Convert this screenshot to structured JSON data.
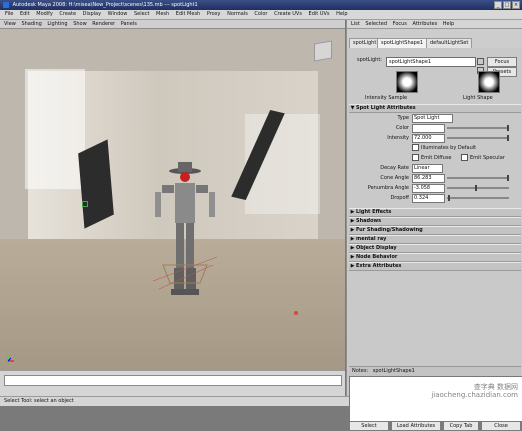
{
  "window": {
    "title": "Autodesk Maya 2008: H:\\misea\\New_Project\\scenes\\135.mb   ---   spotLight1",
    "buttons": [
      "_",
      "□",
      "×"
    ]
  },
  "main_menu": [
    "File",
    "Edit",
    "Modify",
    "Create",
    "Display",
    "Window",
    "Select",
    "Mesh",
    "Edit Mesh",
    "Proxy",
    "Normals",
    "Color",
    "Create UVs",
    "Edit UVs",
    "Help"
  ],
  "viewport_menu": [
    "View",
    "Shading",
    "Lighting",
    "Show",
    "Renderer",
    "Panels"
  ],
  "panel_menu": [
    "List",
    "Selected",
    "Focus",
    "Attributes",
    "Help"
  ],
  "tabs": [
    "spotLight1",
    "spotLightShape1",
    "defaultLightSet"
  ],
  "spotlight": {
    "label": "spotLight:",
    "value": "spotLightShape1",
    "focus": "Focus",
    "presets": "Presets",
    "intensity_sample": "Intensity Sample",
    "light_shape": "Light Shape"
  },
  "spot_light_attributes": {
    "title": "Spot Light Attributes",
    "type_label": "Type",
    "type_value": "Spot Light",
    "color_label": "Color",
    "intensity_label": "Intensity",
    "intensity_value": "72.000",
    "intensity_level": 0.72,
    "illuminates": "Illuminates by Default",
    "emit_diffuse": "Emit Diffuse",
    "emit_specular": "Emit Specular",
    "decay_label": "Decay Rate",
    "decay_value": "Linear",
    "cone_label": "Cone Angle",
    "cone_value": "86.283",
    "penumbra_label": "Penumbra Angle",
    "penumbra_value": "-3.058",
    "dropoff_label": "Dropoff",
    "dropoff_value": "0.324"
  },
  "sections": [
    "Light Effects",
    "Shadows",
    "Fur Shading/Shadowing",
    "mental ray",
    "Object Display",
    "Node Behavior",
    "Extra Attributes"
  ],
  "notes": {
    "label": "Notes:",
    "value": "spotLightShape1"
  },
  "bottom_buttons": [
    "Select",
    "Load Attributes",
    "Copy Tab",
    "Close"
  ],
  "status": "Select Tool: select an object",
  "watermark": {
    "line1": "查字典 数据网",
    "line2": "jiaocheng.chazidian.com"
  }
}
